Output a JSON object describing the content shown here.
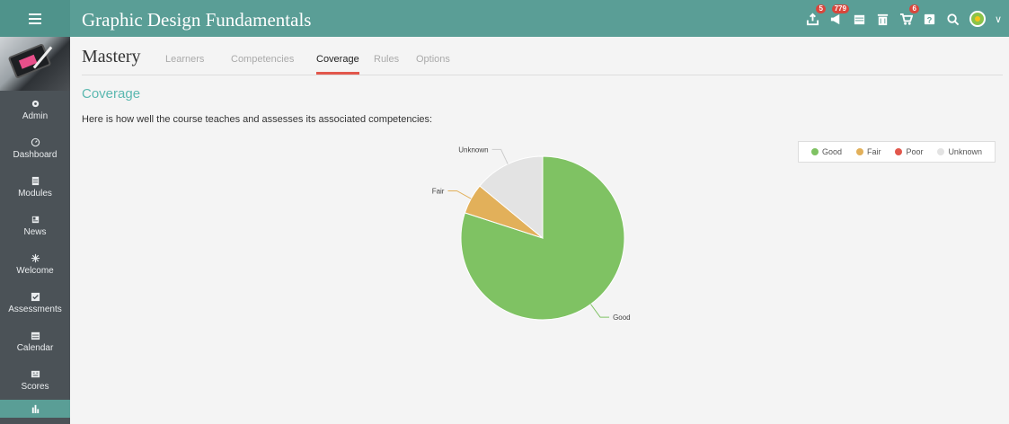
{
  "app": {
    "course_title": "Graphic Design Fundamentals"
  },
  "topbar": {
    "icons": [
      {
        "name": "upload-icon",
        "badge": "5"
      },
      {
        "name": "megaphone-icon",
        "badge": "779"
      },
      {
        "name": "calendar-icon",
        "badge": ""
      },
      {
        "name": "trash-icon",
        "badge": ""
      },
      {
        "name": "cart-icon",
        "badge": "6"
      },
      {
        "name": "help-icon",
        "badge": ""
      },
      {
        "name": "search-icon",
        "badge": ""
      }
    ],
    "chevron": "∨"
  },
  "sidebar": {
    "items": [
      {
        "label": "Admin",
        "icon": "gear-icon"
      },
      {
        "label": "Dashboard",
        "icon": "dashboard-icon"
      },
      {
        "label": "Modules",
        "icon": "modules-icon"
      },
      {
        "label": "News",
        "icon": "news-icon"
      },
      {
        "label": "Welcome",
        "icon": "welcome-icon"
      },
      {
        "label": "Assessments",
        "icon": "assessments-icon"
      },
      {
        "label": "Calendar",
        "icon": "calendar-icon"
      },
      {
        "label": "Scores",
        "icon": "scores-icon"
      },
      {
        "label": "",
        "icon": "bar-chart-icon"
      }
    ]
  },
  "page": {
    "heading": "Mastery",
    "tabs": [
      {
        "label": "Learners",
        "active": false
      },
      {
        "label": "Competencies",
        "active": false
      },
      {
        "label": "Coverage",
        "active": true
      },
      {
        "label": "Rules",
        "active": false
      },
      {
        "label": "Options",
        "active": false
      }
    ],
    "section_title": "Coverage",
    "intro": "Here is how well the course teaches and assesses its associated competencies:"
  },
  "colors": {
    "accent": "#5a9e96",
    "good": "#7fc263",
    "fair": "#e2b05a",
    "poor": "#e2574c",
    "unknown": "#e3e3e3",
    "active_tab": "#e2574c"
  },
  "chart_data": {
    "type": "pie",
    "categories": [
      "Good",
      "Fair",
      "Poor",
      "Unknown"
    ],
    "values": [
      80,
      6,
      0,
      14
    ],
    "legend": "top-right"
  }
}
